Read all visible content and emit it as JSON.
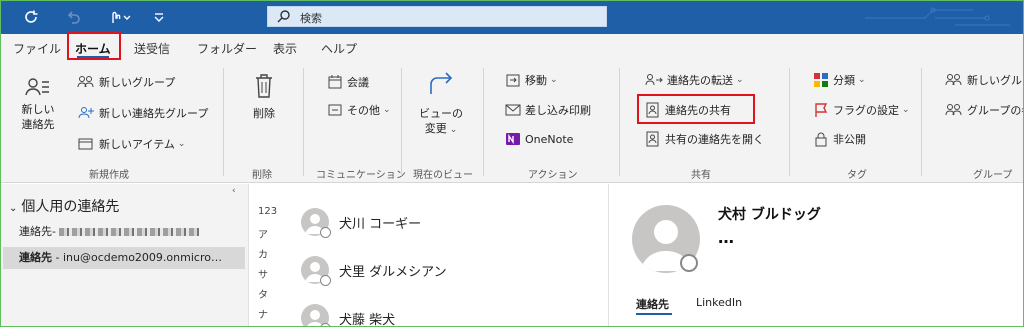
{
  "titlebar": {
    "search_placeholder": "検索",
    "icons": [
      "sync-icon",
      "undo-icon",
      "touch-mode-icon",
      "customize-icon"
    ]
  },
  "tabs": [
    {
      "label": "ファイル"
    },
    {
      "label": "ホーム",
      "active": true
    },
    {
      "label": "送受信"
    },
    {
      "label": "フォルダー"
    },
    {
      "label": "表示"
    },
    {
      "label": "ヘルプ"
    }
  ],
  "ribbon": {
    "new": {
      "big_label_1": "新しい",
      "big_label_2": "連絡先",
      "new_group": "新しいグループ",
      "new_contact_group": "新しい連絡先グループ",
      "new_item": "新しいアイテム",
      "group_label": "新規作成"
    },
    "delete": {
      "label": "削除",
      "group_label": "削除"
    },
    "communication": {
      "meeting": "会議",
      "more": "その他",
      "group_label": "コミュニケーション"
    },
    "view": {
      "label_1": "ビューの",
      "label_2": "変更",
      "group_label": "現在のビュー"
    },
    "actions": {
      "move": "移動",
      "mail_merge": "差し込み印刷",
      "onenote": "OneNote",
      "group_label": "アクション"
    },
    "share": {
      "forward": "連絡先の転送",
      "share_contacts": "連絡先の共有",
      "open_shared": "共有の連絡先を開く",
      "group_label": "共有"
    },
    "tags": {
      "categorize": "分類",
      "follow_up": "フラグの設定",
      "private": "非公開",
      "group_label": "タグ"
    },
    "groups": {
      "new_group": "新しいグループ",
      "browse_groups": "グループの参",
      "group_label": "グループ"
    }
  },
  "nav": {
    "header": "個人用の連絡先",
    "items": [
      {
        "key": "連絡先",
        "value": "-"
      },
      {
        "key": "連絡先",
        "value": " - inu@ocdemo2009.onmicro…"
      }
    ]
  },
  "index_letters": [
    "123",
    "ア",
    "カ",
    "サ",
    "タ",
    "ナ"
  ],
  "contacts": [
    {
      "name": "犬川 コーギー"
    },
    {
      "name": "犬里 ダルメシアン"
    },
    {
      "name": "犬藤 柴犬"
    }
  ],
  "detail": {
    "name": "犬村 ブルドッグ",
    "more": "…",
    "tabs": [
      "連絡先",
      "LinkedIn"
    ]
  },
  "colors": {
    "titlebar": "#1f5fa8",
    "highlight": "#e0141e",
    "ribbon": "#f3f3f3"
  }
}
